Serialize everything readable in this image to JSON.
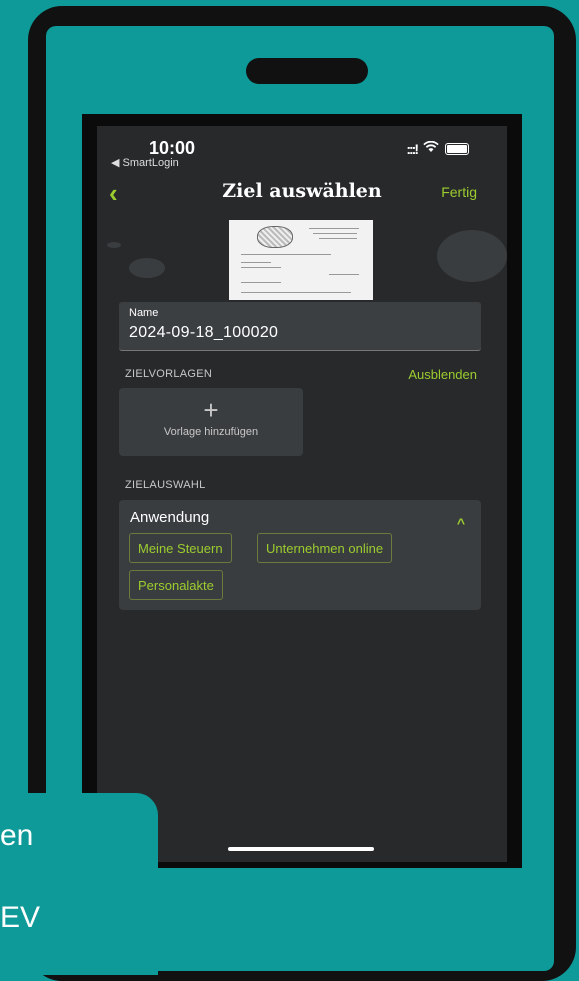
{
  "status_bar": {
    "time": "10:00",
    "back_app": "◀ SmartLogin",
    "signal": ":::!",
    "wifi": "wifi-icon",
    "battery": "battery-icon"
  },
  "nav": {
    "back_icon": "chevron-left-icon",
    "title": "Ziel auswählen",
    "done_label": "Fertig"
  },
  "document": {
    "thumbnail": "scanned-document-thumbnail"
  },
  "name_field": {
    "label": "Name",
    "value": "2024-09-18_100020"
  },
  "templates": {
    "section_label": "ZIELVORLAGEN",
    "hide_label": "Ausblenden",
    "add_icon": "+",
    "add_label": "Vorlage hinzufügen"
  },
  "target_selection": {
    "section_label": "ZIELAUSWAHL",
    "group_title": "Anwendung",
    "collapse_icon": "^",
    "options": [
      "Meine Steuern",
      "Unternehmen online",
      "Personalakte"
    ]
  },
  "overlay": {
    "line1": "en",
    "line2": "EV"
  },
  "colors": {
    "accent": "#9ccd2e",
    "background": "#0e9a98",
    "screen": "#27292b"
  }
}
